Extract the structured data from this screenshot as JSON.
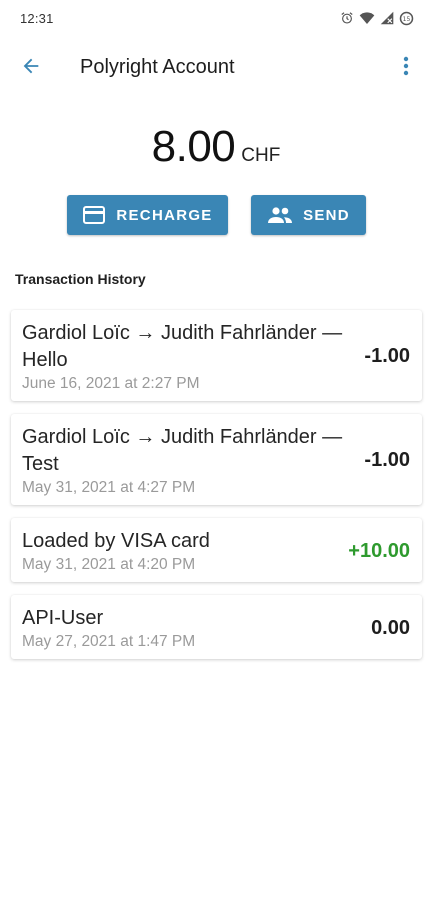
{
  "status_bar": {
    "time": "12:31",
    "icons": [
      "alarm-icon",
      "wifi-icon",
      "signal-icon",
      "battery-icon"
    ]
  },
  "app_bar": {
    "title": "Polyright Account",
    "back_icon": "arrow-back-icon",
    "menu_icon": "more-vert-icon"
  },
  "balance": {
    "amount": "8.00",
    "currency": "CHF"
  },
  "actions": {
    "recharge_label": "RECHARGE",
    "send_label": "SEND",
    "recharge_icon": "credit-card-icon",
    "send_icon": "people-icon"
  },
  "colors": {
    "primary": "#3a86b5",
    "positive": "#2e9a2e",
    "muted": "#9a9a9a"
  },
  "history": {
    "title": "Transaction History",
    "transactions": [
      {
        "description": "Gardiol Loïc → Judith Fahrländer — Hello",
        "date": "June 16, 2021 at 2:27 PM",
        "amount": "-1.00",
        "type": "debit"
      },
      {
        "description": "Gardiol Loïc → Judith Fahrländer — Test",
        "date": "May 31, 2021 at 4:27 PM",
        "amount": "-1.00",
        "type": "debit"
      },
      {
        "description": "Loaded by VISA card",
        "date": "May 31, 2021 at 4:20 PM",
        "amount": "+10.00",
        "type": "credit"
      },
      {
        "description": "API-User",
        "date": "May 27, 2021 at 1:47 PM",
        "amount": "0.00",
        "type": "neutral"
      }
    ]
  }
}
